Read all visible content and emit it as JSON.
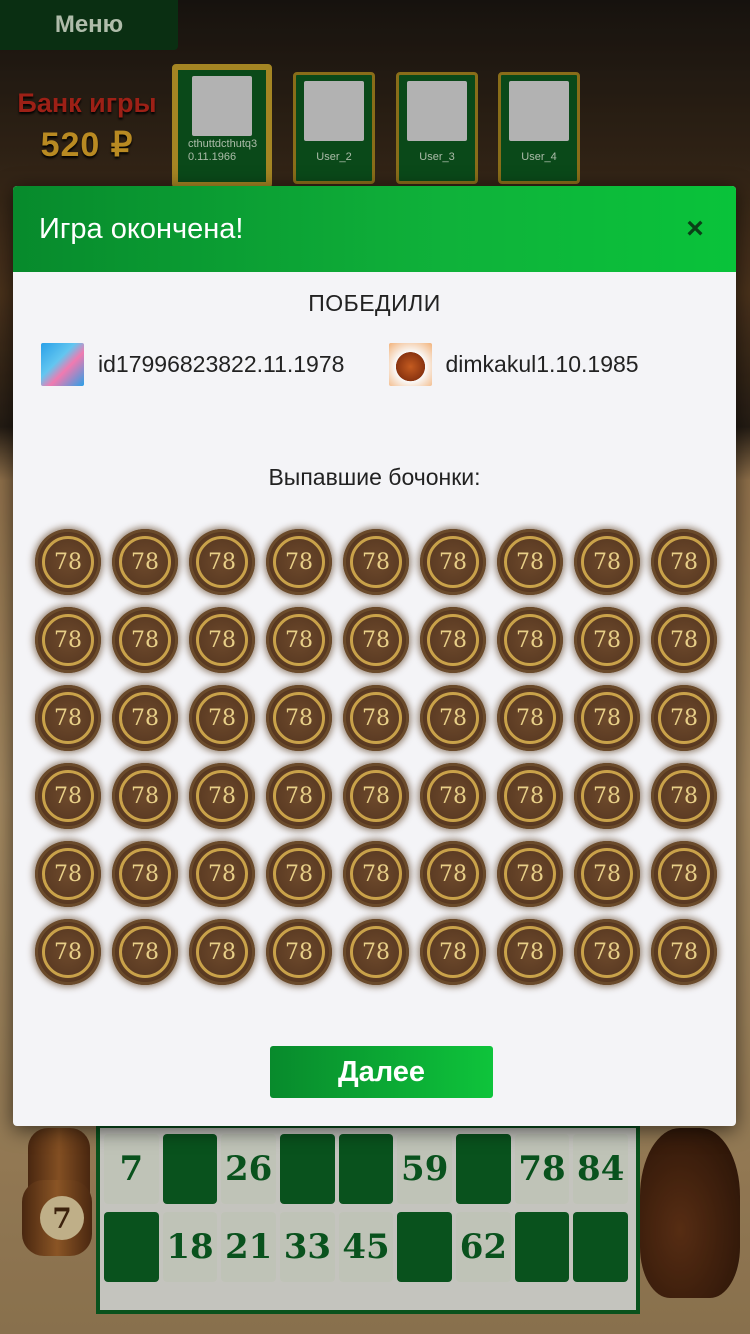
{
  "menu": {
    "label": "Меню"
  },
  "bank": {
    "title": "Банк игры",
    "amount": "520 ₽"
  },
  "players": [
    {
      "name": "cthuttdcthutq30.11.1966",
      "active": true
    },
    {
      "name": "User_2",
      "active": false
    },
    {
      "name": "User_3",
      "active": false
    },
    {
      "name": "User_4",
      "active": false
    }
  ],
  "modal": {
    "title": "Игра окончена!",
    "close_label": "×",
    "winners_label": "ПОБЕДИЛИ",
    "winners": [
      {
        "name": "id17996823822.11.1978",
        "avatar": "cartoon-avatar"
      },
      {
        "name": "dimkakul1.10.1985",
        "avatar": "domokun-avatar"
      }
    ],
    "drawn_label": "Выпавшие бочонки:",
    "drawn_barrels": [
      "78",
      "78",
      "78",
      "78",
      "78",
      "78",
      "78",
      "78",
      "78",
      "78",
      "78",
      "78",
      "78",
      "78",
      "78",
      "78",
      "78",
      "78",
      "78",
      "78",
      "78",
      "78",
      "78",
      "78",
      "78",
      "78",
      "78",
      "78",
      "78",
      "78",
      "78",
      "78",
      "78",
      "78",
      "78",
      "78",
      "78",
      "78",
      "78",
      "78",
      "78",
      "78",
      "78",
      "78",
      "78",
      "78",
      "78",
      "78",
      "78",
      "78",
      "78",
      "78",
      "78",
      "78"
    ],
    "next_label": "Далее"
  },
  "card": {
    "rows": [
      [
        "7",
        "",
        "26",
        "",
        "",
        "59",
        "",
        "78",
        "84"
      ],
      [
        "",
        "18",
        "21",
        "33",
        "45",
        "",
        "62",
        "",
        ""
      ]
    ]
  },
  "side_barrel": {
    "number": "7"
  },
  "colors": {
    "header_green": "#0fb23a",
    "card_green": "#0c6424",
    "bank_red": "#c0281c",
    "bank_gold": "#e2a92a"
  }
}
